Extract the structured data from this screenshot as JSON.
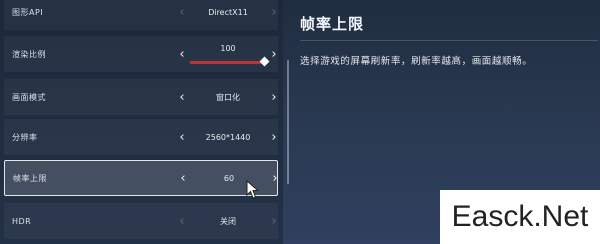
{
  "settings": {
    "rows": [
      {
        "label": "图形API",
        "value": "DirectX11",
        "arrows_dim": true
      },
      {
        "label": "渲染比例",
        "value": "100",
        "slider_fill_fraction": 0.95
      },
      {
        "label": "画面模式",
        "value": "窗口化"
      },
      {
        "label": "分辨率",
        "value": "2560*1440"
      },
      {
        "label": "帧率上限",
        "value": "60",
        "selected": true
      },
      {
        "label": "HDR",
        "value": "关闭",
        "arrows_dim": true
      }
    ],
    "arrow_left": "‹",
    "arrow_right": "›"
  },
  "detail": {
    "title": "帧率上限",
    "description": "选择游戏的屏幕刷新率，刷新率越高，画面越顺畅。"
  },
  "watermark": "Easck.Net",
  "colors": {
    "slider_fill": "#b8343b",
    "selected_border": "#ffffff"
  }
}
